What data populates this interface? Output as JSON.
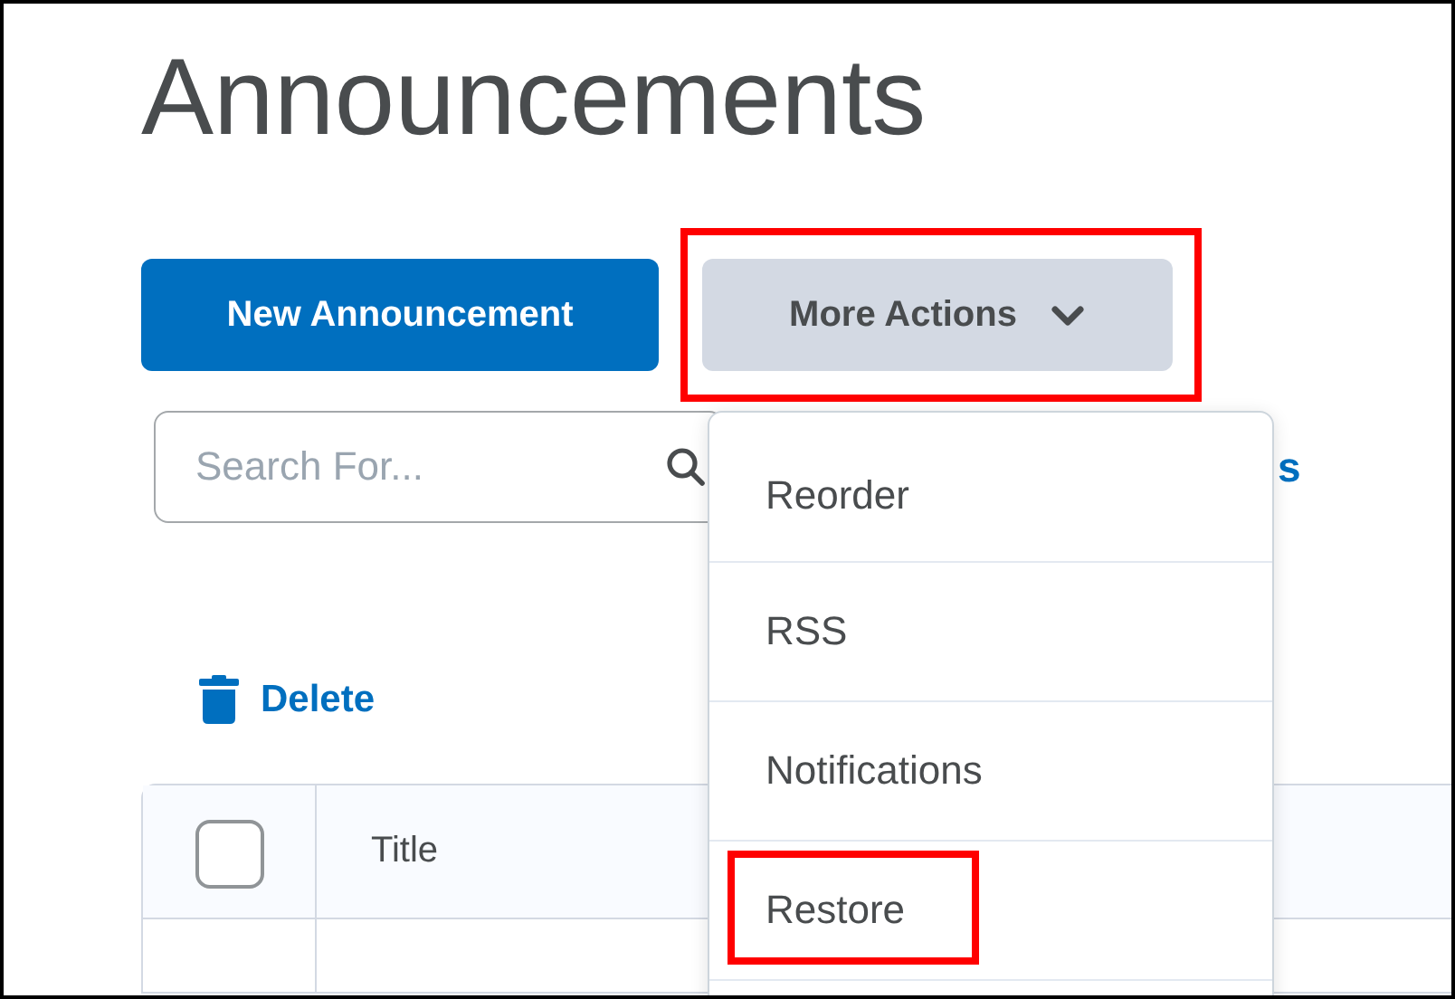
{
  "page_title": "Announcements",
  "toolbar": {
    "primary_button": "New Announcement",
    "more_button": {
      "label": "More Actions",
      "highlighted": true
    }
  },
  "search": {
    "placeholder": "Search For..."
  },
  "partial_link": "s",
  "delete_button": "Delete",
  "table": {
    "header_checkbox": {
      "checked": false
    },
    "columns": [
      "Title"
    ]
  },
  "menu": [
    {
      "label": "Reorder",
      "highlighted": false
    },
    {
      "label": "RSS",
      "highlighted": false
    },
    {
      "label": "Notifications",
      "highlighted": false
    },
    {
      "label": "Restore",
      "highlighted": true
    }
  ]
}
